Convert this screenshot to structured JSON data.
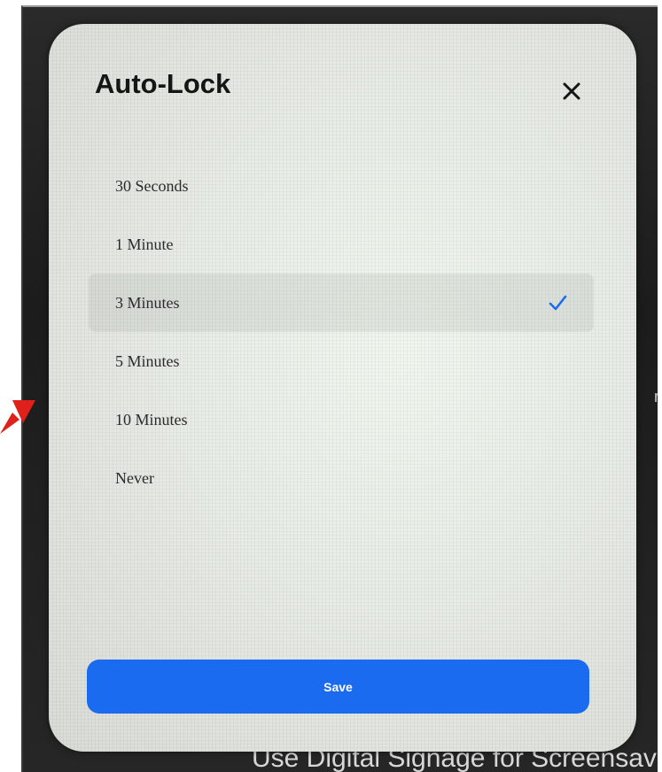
{
  "modal": {
    "title": "Auto-Lock",
    "options": [
      {
        "label": "30 Seconds",
        "selected": false
      },
      {
        "label": "1 Minute",
        "selected": false
      },
      {
        "label": "3 Minutes",
        "selected": true
      },
      {
        "label": "5 Minutes",
        "selected": false
      },
      {
        "label": "10 Minutes",
        "selected": false
      },
      {
        "label": "Never",
        "selected": false
      }
    ],
    "save_label": "Save"
  },
  "background": {
    "partial_text": "Use Digital Signage for Screensaver",
    "side_glyph": "rs"
  },
  "colors": {
    "accent": "#1a6bf0",
    "check": "#1a6bf0",
    "annotation_arrow": "#e0201a"
  },
  "icons": {
    "close": "close-icon",
    "check": "check-icon"
  }
}
